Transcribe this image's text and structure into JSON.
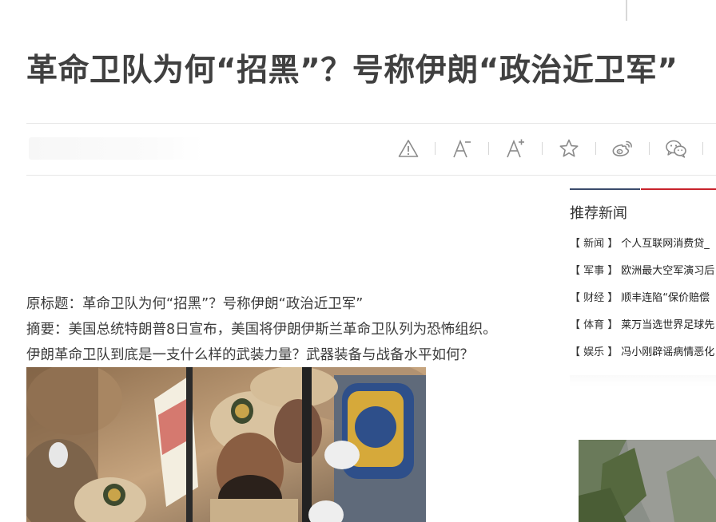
{
  "article": {
    "title": "革命卫队为何“招黑”？号称伊朗“政治近卫军”",
    "lead": [
      "原标题：革命卫队为何“招黑”？号称伊朗“政治近卫军”",
      "摘要：美国总统特朗普8日宣布，美国将伊朗伊斯兰革命卫队列为恐怖组织。",
      "伊朗革命卫队到底是一支什么样的武装力量？武器装备与战备水平如何？"
    ]
  },
  "toolbar": {
    "icons": [
      "warning-icon",
      "font-decrease-icon",
      "font-increase-icon",
      "star-icon",
      "weibo-icon",
      "wechat-icon"
    ]
  },
  "sidebar": {
    "title": "推荐新闻",
    "items": [
      {
        "category": "【 新闻 】",
        "text": "个人互联网消费贷_"
      },
      {
        "category": "【 军事 】",
        "text": "欧洲最大空军演习后"
      },
      {
        "category": "【 财经 】",
        "text": "顺丰连陷“保价赔偿"
      },
      {
        "category": "【 体育 】",
        "text": "莱万当选世界足球先"
      },
      {
        "category": "【 娱乐 】",
        "text": "冯小刚辟谣病情恶化"
      }
    ]
  },
  "colors": {
    "tab_dark": "#3a4b6b",
    "tab_red": "#c8232c",
    "headline": "#404040",
    "icon": "#8a8a8a"
  }
}
